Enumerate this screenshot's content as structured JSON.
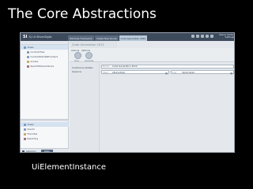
{
  "slide": {
    "title": "The Core Abstractions",
    "caption": "UiElementInstance"
  },
  "app": {
    "brand_mark": "SΙ",
    "brand_text": "S) UI SilverSight",
    "top_tabs": [
      "Windows Framework",
      "Create New Quote",
      "Code Generation 2012"
    ],
    "active_top_tab": 2,
    "user_line1": "Owner Admin",
    "user_line2": "Settings"
  },
  "sidebar": {
    "tree": [
      {
        "label": "Views",
        "selected": true
      },
      {
        "label": "ContractTree",
        "selected": false
      },
      {
        "label": "ContractItemRefinement",
        "selected": false
      },
      {
        "label": "Access",
        "selected": false
      },
      {
        "label": "SpecificElementLinks",
        "selected": false
      }
    ],
    "bottom_items": [
      {
        "label": "Views",
        "selected": true
      },
      {
        "label": "Search",
        "selected": false
      },
      {
        "label": "Favorites",
        "selected": false
      },
      {
        "label": "Reporting",
        "selected": false
      }
    ],
    "footer_label": "Selection",
    "footer_button": "Open"
  },
  "main": {
    "content_title": "Code Generation 2012",
    "ribbon_tabs": [
      "Actions",
      "Options"
    ],
    "ribbon_buttons": [
      "Save",
      "Generate"
    ],
    "ribbon_group": "Actions",
    "left_items": [
      "Conference Details",
      "Sessions"
    ],
    "form": {
      "name_label": "Name",
      "name_value": "Code Generation 2012",
      "start_label": "Start",
      "start_value": "28.03.2012",
      "end_label": "End",
      "end_value": "30.03.2012"
    }
  }
}
